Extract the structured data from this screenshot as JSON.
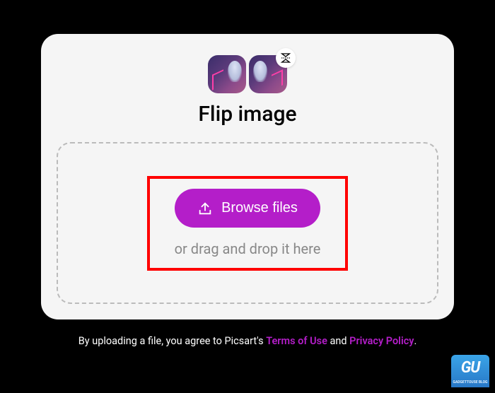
{
  "title": "Flip image",
  "dropzone": {
    "browse_label": "Browse files",
    "hint": "or drag and drop it here"
  },
  "footer": {
    "prefix": "By uploading a file, you agree to Picsart's ",
    "terms_label": "Terms of Use",
    "and_text": " and ",
    "privacy_label": "Privacy Policy",
    "suffix": "."
  },
  "watermark": "GU"
}
